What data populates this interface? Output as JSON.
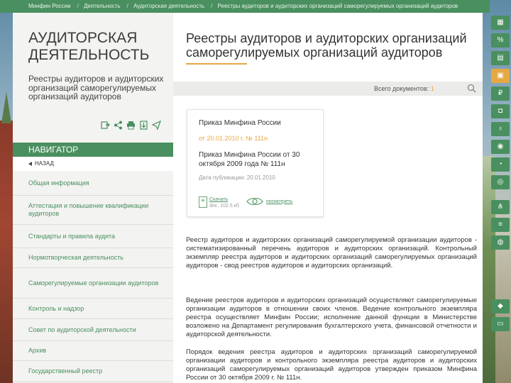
{
  "breadcrumb": [
    "Минфин России",
    "Деятельность",
    "Аудиторская деятельность",
    "Реестры аудиторов и аудиторских организаций саморегулируемых организаций аудиторов"
  ],
  "section": {
    "title": "АУДИТОРСКАЯ ДЕЯТЕЛЬНОСТЬ",
    "subtitle": "Реестры аудиторов и аудиторских организаций саморегулируемых организаций аудиторов"
  },
  "share_icons": [
    "save-icon",
    "share-icon",
    "print-icon",
    "download-icon",
    "send-icon"
  ],
  "navigator": {
    "header": "НАВИГАТОР",
    "back": "НАЗАД",
    "items": [
      "Общая информация",
      "Аттестация и повышение квалификации аудиторов",
      "Стандарты и правила аудита",
      "Нормотворческая деятельность",
      "Саморегулируемые организации аудиторов",
      "Контроль и надзор",
      "Совет по аудиторской деятельности",
      "Архив",
      "Государственный реестр"
    ]
  },
  "main": {
    "title": "Реестры аудиторов и аудиторских организаций саморегулируемых организаций аудиторов",
    "doc_count_label": "Всего документов:",
    "doc_count": "1"
  },
  "document_card": {
    "title": "Приказ Минфина России",
    "date": "от 20.01.2010 г. № 111н",
    "description": "Приказ Минфина России от 30 октября 2009 года № 111н",
    "published": "Дата публикации: 20.01.2010",
    "download_label": "Скачать",
    "download_size": "doc, 102.5 кб",
    "view_label": "посмотреть"
  },
  "body": [
    "Реестр аудиторов и аудиторских организаций саморегулируемой организации аудиторов - систематизированный перечень аудиторов и аудиторских организаций. Контрольный экземпляр реестра аудиторов и аудиторских организаций саморегулируемых организаций аудиторов - свод реестров аудиторов и аудиторских организаций.",
    "Ведение реестров аудиторов и аудиторских организаций осуществляют саморегулируемые организации аудиторов в отношении своих членов. Ведение контрольного экземпляра реестра осуществляет Минфин России; исполнение данной функции в Министерстве возложено на Департамент регулирования бухгалтерского учета, финансовой отчетности и аудиторской деятельности.",
    "Порядок ведения реестра аудиторов и аудиторских организаций саморегулируемой организации аудиторов и контрольного экземпляра реестра аудиторов и аудиторских организаций саморегулируемых организаций аудиторов утвержден приказом Минфина России от 30 октября 2009 г. № 111н."
  ],
  "toolbar": {
    "icons": [
      "calculator-icon",
      "percent-icon",
      "grid-icon",
      "document-icon",
      "ruble-icon",
      "photo-icon",
      "money-bag-icon",
      "ruble-coin-icon",
      "chart-icon",
      "coins-icon",
      "hierarchy-icon",
      "bars-icon",
      "globe-icon",
      "diamond-icon",
      "cards-icon"
    ],
    "active_index": 3
  }
}
